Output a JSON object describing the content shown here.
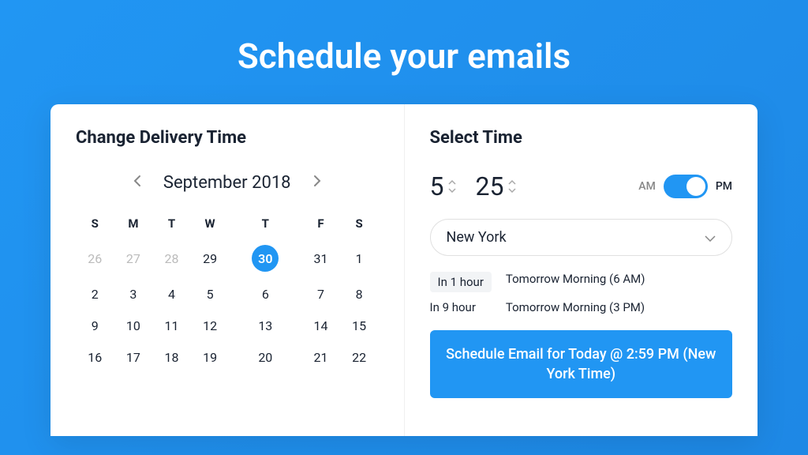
{
  "hero": {
    "title": "Schedule your emails"
  },
  "left": {
    "title": "Change Delivery Time",
    "month": "September 2018",
    "weekdays": [
      "S",
      "M",
      "T",
      "W",
      "T",
      "F",
      "S"
    ],
    "grid": [
      [
        {
          "d": "26",
          "muted": true
        },
        {
          "d": "27",
          "muted": true
        },
        {
          "d": "28",
          "muted": true
        },
        {
          "d": "29"
        },
        {
          "d": "30",
          "selected": true
        },
        {
          "d": "31"
        },
        {
          "d": "1"
        }
      ],
      [
        {
          "d": "2"
        },
        {
          "d": "3"
        },
        {
          "d": "4"
        },
        {
          "d": "5"
        },
        {
          "d": "6"
        },
        {
          "d": "7"
        },
        {
          "d": "8"
        }
      ],
      [
        {
          "d": "9"
        },
        {
          "d": "10"
        },
        {
          "d": "11"
        },
        {
          "d": "12"
        },
        {
          "d": "13"
        },
        {
          "d": "14"
        },
        {
          "d": "15"
        }
      ],
      [
        {
          "d": "16"
        },
        {
          "d": "17"
        },
        {
          "d": "18"
        },
        {
          "d": "19"
        },
        {
          "d": "20"
        },
        {
          "d": "21"
        },
        {
          "d": "22"
        }
      ]
    ]
  },
  "right": {
    "title": "Select Time",
    "hour": "5",
    "minute": "25",
    "am_label": "AM",
    "pm_label": "PM",
    "timezone": "New York",
    "quick": [
      {
        "left": "In 1 hour",
        "right": "Tomorrow Morning (6 AM)",
        "boxed": true
      },
      {
        "left": "In 9 hour",
        "right": "Tomorrow Morning (3 PM)",
        "boxed": false
      }
    ],
    "schedule_button": "Schedule Email for Today @ 2:59 PM (New York Time)"
  }
}
